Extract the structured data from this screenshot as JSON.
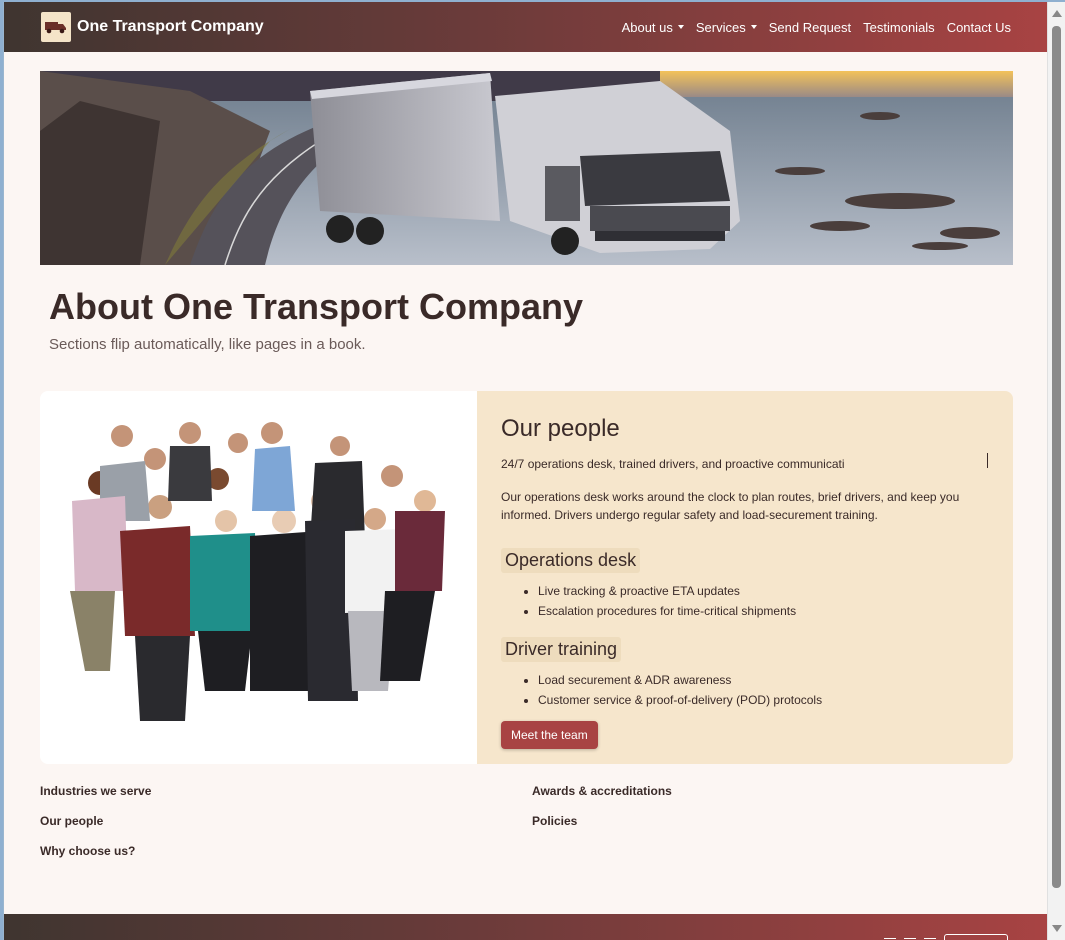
{
  "brand": {
    "name": "One Transport Company",
    "logo_icon": "truck-icon"
  },
  "nav": {
    "items": [
      {
        "label": "About us",
        "dropdown": true
      },
      {
        "label": "Services",
        "dropdown": true
      },
      {
        "label": "Send Request",
        "dropdown": false
      },
      {
        "label": "Testimonials",
        "dropdown": false
      },
      {
        "label": "Contact Us",
        "dropdown": false
      }
    ]
  },
  "hero": {
    "image": "truck-on-coastal-road"
  },
  "page": {
    "title": "About One Transport Company",
    "subtitle": "Sections flip automatically, like pages in a book."
  },
  "card": {
    "image": "group-of-people",
    "title": "Our people",
    "tagline": "24/7 operations desk, trained drivers, and proactive communicati",
    "description": "Our operations desk works around the clock to plan routes, brief drivers, and keep you informed. Drivers undergo regular safety and load-securement training.",
    "sections": [
      {
        "heading": "Operations desk",
        "bullets": [
          "Live tracking & proactive ETA updates",
          "Escalation procedures for time-critical shipments"
        ]
      },
      {
        "heading": "Driver training",
        "bullets": [
          "Load securement & ADR awareness",
          "Customer service & proof-of-delivery (POD) protocols"
        ]
      }
    ],
    "button_label": "Meet the team"
  },
  "links": {
    "left": [
      "Industries we serve",
      "Our people",
      "Why choose us?"
    ],
    "right": [
      "Awards & accreditations",
      "Policies"
    ]
  },
  "colors": {
    "accent": "#a84343",
    "card_bg": "#f6e6cc",
    "page_bg": "#fcf6f3",
    "text": "#3a2a28"
  }
}
